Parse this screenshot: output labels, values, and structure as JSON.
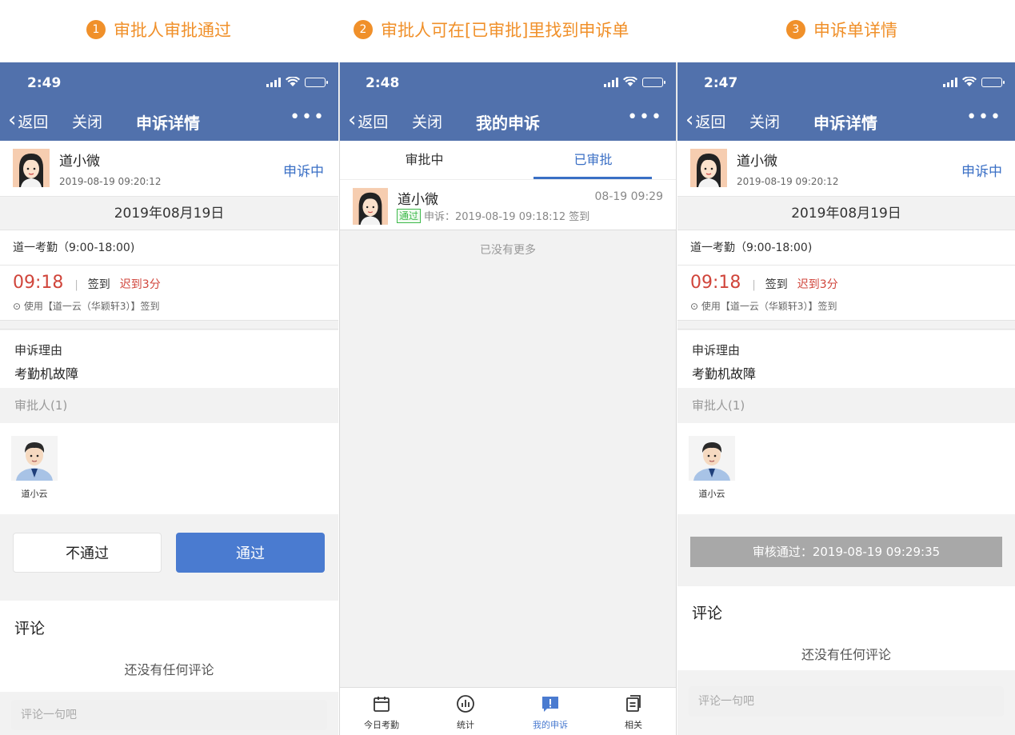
{
  "steps": [
    {
      "num": "1",
      "label": "审批人审批通过"
    },
    {
      "num": "2",
      "label": "审批人可在[已审批]里找到申诉单"
    },
    {
      "num": "3",
      "label": "申诉单详情"
    }
  ],
  "colors": {
    "step": "#f0902a",
    "header": "#5171ac",
    "accent": "#3a6fc5",
    "late": "#d0453b",
    "approve_button": "#4a7bd0",
    "badge": "#3db94a"
  },
  "phone1": {
    "status_time": "2:49",
    "nav": {
      "back": "返回",
      "close": "关闭",
      "title": "申诉详情",
      "more": "•••"
    },
    "user": {
      "name": "道小微",
      "time": "2019-08-19 09:20:12",
      "status": "申诉中"
    },
    "date": "2019年08月19日",
    "shift": "道一考勤（9:00-18:00)",
    "punch": {
      "time": "09:18",
      "separator": "|",
      "type": "签到",
      "late": "迟到3分",
      "location": "使用【道一云（华颖轩3）】签到",
      "location_icon": "location-pin-icon"
    },
    "reason_label": "申诉理由",
    "reason_value": "考勤机故障",
    "approvers_label": "审批人(1)",
    "approver_name": "道小云",
    "reject_label": "不通过",
    "approve_label": "通过",
    "comment_title": "评论",
    "comment_empty": "还没有任何评论",
    "comment_placeholder": "评论一句吧"
  },
  "phone2": {
    "status_time": "2:48",
    "nav": {
      "back": "返回",
      "close": "关闭",
      "title": "我的申诉",
      "more": "•••"
    },
    "tabs": [
      {
        "label": "审批中"
      },
      {
        "label": "已审批",
        "active": true
      }
    ],
    "item": {
      "name": "道小微",
      "date": "08-19  09:29",
      "badge": "通过",
      "summary": "申诉：2019-08-19 09:18:12 签到"
    },
    "no_more": "已没有更多",
    "tabbar": [
      {
        "label": "今日考勤",
        "icon": "calendar-icon"
      },
      {
        "label": "统计",
        "icon": "chart-icon"
      },
      {
        "label": "我的申诉",
        "icon": "alert-icon",
        "active": true
      },
      {
        "label": "相关",
        "icon": "document-icon"
      }
    ]
  },
  "phone3": {
    "status_time": "2:47",
    "nav": {
      "back": "返回",
      "close": "关闭",
      "title": "申诉详情",
      "more": "•••"
    },
    "user": {
      "name": "道小微",
      "time": "2019-08-19 09:20:12",
      "status": "申诉中"
    },
    "date": "2019年08月19日",
    "shift": "道一考勤（9:00-18:00)",
    "punch": {
      "time": "09:18",
      "separator": "|",
      "type": "签到",
      "late": "迟到3分",
      "location": "使用【道一云（华颖轩3）】签到"
    },
    "reason_label": "申诉理由",
    "reason_value": "考勤机故障",
    "approvers_label": "审批人(1)",
    "approver_name": "道小云",
    "audit_result": "审核通过：2019-08-19 09:29:35",
    "comment_title": "评论",
    "comment_empty": "还没有任何评论",
    "comment_placeholder": "评论一句吧"
  }
}
